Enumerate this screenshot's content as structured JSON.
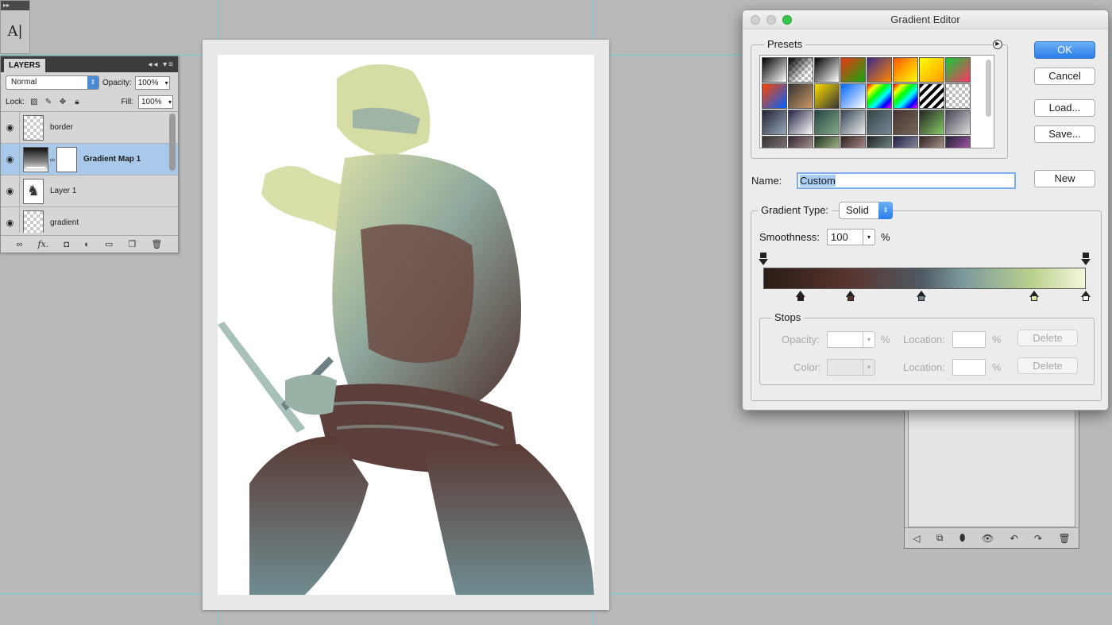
{
  "tools": {
    "head": "▸▸",
    "text_tool": "A|"
  },
  "layers_panel": {
    "tab": "LAYERS",
    "controls": "◂◂ ▾≡",
    "blend_mode": "Normal",
    "opacity_label": "Opacity:",
    "opacity_value": "100%",
    "lock_label": "Lock:",
    "fill_label": "Fill:",
    "fill_value": "100%",
    "layers": [
      {
        "name": "border",
        "selected": false
      },
      {
        "name": "Gradient Map 1",
        "selected": true
      },
      {
        "name": "Layer 1",
        "selected": false
      },
      {
        "name": "gradient",
        "selected": false
      }
    ],
    "footer_icons": [
      "link-icon",
      "fx-icon",
      "mask-icon",
      "adjustment-icon",
      "folder-icon",
      "new-layer-icon",
      "trash-icon"
    ],
    "footer_glyphs": [
      "∞",
      "fx.",
      "◘",
      "◐",
      "▭",
      "❐",
      "🗑"
    ]
  },
  "gradient_editor": {
    "title": "Gradient Editor",
    "presets_label": "Presets",
    "ok": "OK",
    "cancel": "Cancel",
    "load": "Load...",
    "save": "Save...",
    "new": "New",
    "name_label": "Name:",
    "name_value": "Custom",
    "gradient_type_label": "Gradient Type:",
    "gradient_type_value": "Solid",
    "smoothness_label": "Smoothness:",
    "smoothness_value": "100",
    "percent": "%",
    "stops_label": "Stops",
    "opacity_label": "Opacity:",
    "color_label": "Color:",
    "location_label": "Location:",
    "delete": "Delete",
    "color_stops": [
      {
        "location": 0.115,
        "color": "#2a1c15"
      },
      {
        "location": 0.27,
        "color": "#5a3530"
      },
      {
        "location": 0.49,
        "color": "#6e8790"
      },
      {
        "location": 0.84,
        "color": "#e2e7a8"
      },
      {
        "location": 1.0,
        "color": "#ffffff"
      }
    ],
    "opacity_stops": [
      0.0,
      1.0
    ],
    "presets": [
      [
        "#000-#fff",
        "checker-bw",
        "#000-#fff2",
        "#e31-#1a1",
        "#3a2a8a-#f80",
        "#f50-#ff0",
        "#ff0-#f90",
        "#1c3-#f36"
      ],
      [
        "#f40-#0060ff",
        "#333-#c96",
        "#fd0-#333",
        "#06f-#fff",
        "rainbow",
        "rainbow2",
        "stripe",
        "checker"
      ],
      [
        "#223-#9ab",
        "#224-#fff",
        "#244-#8a8",
        "#345-#eee",
        "#344-#789",
        "#433-#765",
        "#222-#8c6",
        "#445-#ddd"
      ],
      [
        "#333-#988",
        "#323-#cba",
        "#232-#cda",
        "#322-#caa",
        "#222-#8aa",
        "#224-#aab",
        "#322-#cba",
        "#223-#c6c"
      ]
    ]
  },
  "history_panel": {
    "footer_icons": [
      "step-back-icon",
      "snapshot-icon",
      "layer-icon",
      "eye-icon",
      "undo-icon",
      "redo-icon",
      "trash-icon"
    ],
    "footer_glyphs": [
      "◁",
      "⧉",
      "⬮",
      "👁",
      "↶",
      "↷",
      "🗑"
    ]
  }
}
